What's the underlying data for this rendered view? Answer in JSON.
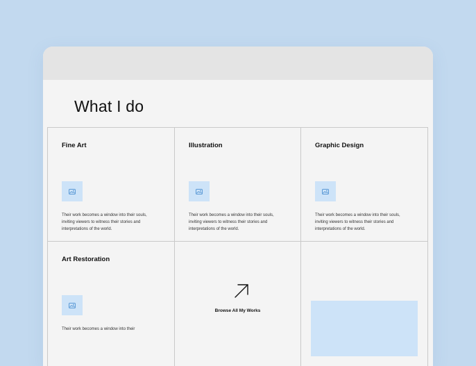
{
  "section": {
    "title": "What I do"
  },
  "services": [
    {
      "title": "Fine Art",
      "description": "Their work becomes a window into their souls, inviting viewers to witness their stories and interpretations of the world.",
      "icon": "image-icon"
    },
    {
      "title": "Illustration",
      "description": "Their work becomes a window into their souls, inviting viewers to witness their stories and interpretations of the world.",
      "icon": "image-icon"
    },
    {
      "title": "Graphic Design",
      "description": "Their work becomes a window into their souls, inviting viewers to witness their stories and interpretations of the world.",
      "icon": "image-icon"
    },
    {
      "title": "Art Restoration",
      "description": "Their work becomes a window into their",
      "icon": "image-icon"
    }
  ],
  "browse": {
    "label": "Browse All My Works",
    "icon": "arrow-up-right-icon"
  },
  "colors": {
    "background": "#c2d9ef",
    "window": "#f4f4f4",
    "titlebar": "#e4e4e4",
    "accent": "#cde3f8",
    "icon_stroke": "#4a8fd1",
    "border": "#c9c9c9"
  }
}
